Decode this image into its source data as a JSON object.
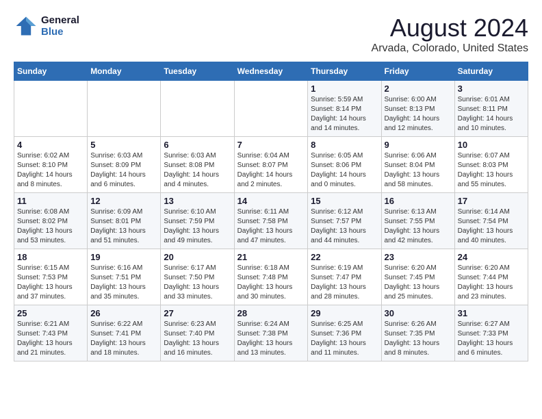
{
  "header": {
    "logo_line1": "General",
    "logo_line2": "Blue",
    "main_title": "August 2024",
    "subtitle": "Arvada, Colorado, United States"
  },
  "weekdays": [
    "Sunday",
    "Monday",
    "Tuesday",
    "Wednesday",
    "Thursday",
    "Friday",
    "Saturday"
  ],
  "weeks": [
    [
      {
        "day": "",
        "info": ""
      },
      {
        "day": "",
        "info": ""
      },
      {
        "day": "",
        "info": ""
      },
      {
        "day": "",
        "info": ""
      },
      {
        "day": "1",
        "info": "Sunrise: 5:59 AM\nSunset: 8:14 PM\nDaylight: 14 hours\nand 14 minutes."
      },
      {
        "day": "2",
        "info": "Sunrise: 6:00 AM\nSunset: 8:13 PM\nDaylight: 14 hours\nand 12 minutes."
      },
      {
        "day": "3",
        "info": "Sunrise: 6:01 AM\nSunset: 8:11 PM\nDaylight: 14 hours\nand 10 minutes."
      }
    ],
    [
      {
        "day": "4",
        "info": "Sunrise: 6:02 AM\nSunset: 8:10 PM\nDaylight: 14 hours\nand 8 minutes."
      },
      {
        "day": "5",
        "info": "Sunrise: 6:03 AM\nSunset: 8:09 PM\nDaylight: 14 hours\nand 6 minutes."
      },
      {
        "day": "6",
        "info": "Sunrise: 6:03 AM\nSunset: 8:08 PM\nDaylight: 14 hours\nand 4 minutes."
      },
      {
        "day": "7",
        "info": "Sunrise: 6:04 AM\nSunset: 8:07 PM\nDaylight: 14 hours\nand 2 minutes."
      },
      {
        "day": "8",
        "info": "Sunrise: 6:05 AM\nSunset: 8:06 PM\nDaylight: 14 hours\nand 0 minutes."
      },
      {
        "day": "9",
        "info": "Sunrise: 6:06 AM\nSunset: 8:04 PM\nDaylight: 13 hours\nand 58 minutes."
      },
      {
        "day": "10",
        "info": "Sunrise: 6:07 AM\nSunset: 8:03 PM\nDaylight: 13 hours\nand 55 minutes."
      }
    ],
    [
      {
        "day": "11",
        "info": "Sunrise: 6:08 AM\nSunset: 8:02 PM\nDaylight: 13 hours\nand 53 minutes."
      },
      {
        "day": "12",
        "info": "Sunrise: 6:09 AM\nSunset: 8:01 PM\nDaylight: 13 hours\nand 51 minutes."
      },
      {
        "day": "13",
        "info": "Sunrise: 6:10 AM\nSunset: 7:59 PM\nDaylight: 13 hours\nand 49 minutes."
      },
      {
        "day": "14",
        "info": "Sunrise: 6:11 AM\nSunset: 7:58 PM\nDaylight: 13 hours\nand 47 minutes."
      },
      {
        "day": "15",
        "info": "Sunrise: 6:12 AM\nSunset: 7:57 PM\nDaylight: 13 hours\nand 44 minutes."
      },
      {
        "day": "16",
        "info": "Sunrise: 6:13 AM\nSunset: 7:55 PM\nDaylight: 13 hours\nand 42 minutes."
      },
      {
        "day": "17",
        "info": "Sunrise: 6:14 AM\nSunset: 7:54 PM\nDaylight: 13 hours\nand 40 minutes."
      }
    ],
    [
      {
        "day": "18",
        "info": "Sunrise: 6:15 AM\nSunset: 7:53 PM\nDaylight: 13 hours\nand 37 minutes."
      },
      {
        "day": "19",
        "info": "Sunrise: 6:16 AM\nSunset: 7:51 PM\nDaylight: 13 hours\nand 35 minutes."
      },
      {
        "day": "20",
        "info": "Sunrise: 6:17 AM\nSunset: 7:50 PM\nDaylight: 13 hours\nand 33 minutes."
      },
      {
        "day": "21",
        "info": "Sunrise: 6:18 AM\nSunset: 7:48 PM\nDaylight: 13 hours\nand 30 minutes."
      },
      {
        "day": "22",
        "info": "Sunrise: 6:19 AM\nSunset: 7:47 PM\nDaylight: 13 hours\nand 28 minutes."
      },
      {
        "day": "23",
        "info": "Sunrise: 6:20 AM\nSunset: 7:45 PM\nDaylight: 13 hours\nand 25 minutes."
      },
      {
        "day": "24",
        "info": "Sunrise: 6:20 AM\nSunset: 7:44 PM\nDaylight: 13 hours\nand 23 minutes."
      }
    ],
    [
      {
        "day": "25",
        "info": "Sunrise: 6:21 AM\nSunset: 7:43 PM\nDaylight: 13 hours\nand 21 minutes."
      },
      {
        "day": "26",
        "info": "Sunrise: 6:22 AM\nSunset: 7:41 PM\nDaylight: 13 hours\nand 18 minutes."
      },
      {
        "day": "27",
        "info": "Sunrise: 6:23 AM\nSunset: 7:40 PM\nDaylight: 13 hours\nand 16 minutes."
      },
      {
        "day": "28",
        "info": "Sunrise: 6:24 AM\nSunset: 7:38 PM\nDaylight: 13 hours\nand 13 minutes."
      },
      {
        "day": "29",
        "info": "Sunrise: 6:25 AM\nSunset: 7:36 PM\nDaylight: 13 hours\nand 11 minutes."
      },
      {
        "day": "30",
        "info": "Sunrise: 6:26 AM\nSunset: 7:35 PM\nDaylight: 13 hours\nand 8 minutes."
      },
      {
        "day": "31",
        "info": "Sunrise: 6:27 AM\nSunset: 7:33 PM\nDaylight: 13 hours\nand 6 minutes."
      }
    ]
  ]
}
